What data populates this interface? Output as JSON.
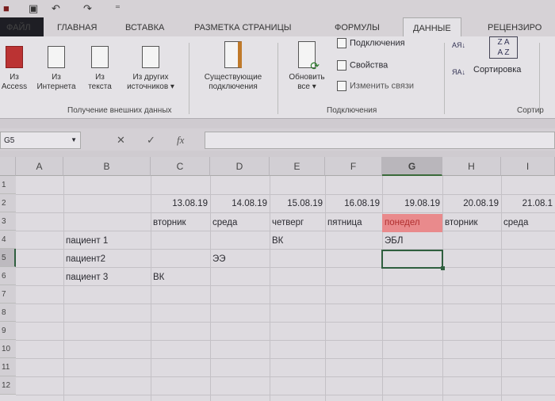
{
  "qat": {
    "icons": [
      "excel-icon",
      "save-icon",
      "undo-icon",
      "redo-icon",
      "customize-icon"
    ]
  },
  "tabs": [
    "ФАЙЛ",
    "ГЛАВНАЯ",
    "ВСТАВКА",
    "РАЗМЕТКА СТРАНИЦЫ",
    "ФОРМУЛЫ",
    "ДАННЫЕ",
    "РЕЦЕНЗИРО"
  ],
  "active_tab": "ДАННЫЕ",
  "ribbon": {
    "external": {
      "label": "Получение внешних данных",
      "buttons": [
        {
          "l1": "Из",
          "l2": "Access"
        },
        {
          "l1": "Из",
          "l2": "Интернета"
        },
        {
          "l1": "Из",
          "l2": "текста"
        },
        {
          "l1": "Из других",
          "l2": "источников ▾"
        }
      ]
    },
    "existing": {
      "l1": "Существующие",
      "l2": "подключения"
    },
    "connections": {
      "label": "Подключения",
      "refresh_l1": "Обновить",
      "refresh_l2": "все ▾",
      "items": [
        "Подключения",
        "Свойства",
        "Изменить связи"
      ]
    },
    "sort": {
      "label": "Сортир",
      "sort": "Сортировка",
      "az": "АЯ",
      "za": "ЯА"
    }
  },
  "formula": {
    "name_box": "G5",
    "cancel": "✕",
    "enter": "✓",
    "fx": "fx",
    "value": ""
  },
  "columns": [
    "A",
    "B",
    "C",
    "D",
    "E",
    "F",
    "G",
    "H",
    "I"
  ],
  "selected_column": "G",
  "rows": [
    "1",
    "2",
    "3",
    "4",
    "5",
    "6",
    "7",
    "8",
    "9",
    "10",
    "11",
    "12"
  ],
  "cells": {
    "dates": [
      "13.08.19",
      "14.08.19",
      "15.08.19",
      "16.08.19",
      "19.08.19",
      "20.08.19",
      "21.08.1"
    ],
    "days": [
      "вторник",
      "среда",
      "четверг",
      "пятница",
      "понедел",
      "вторник",
      "среда"
    ],
    "patients": [
      "пациент 1",
      "пациент2",
      "пациент 3"
    ],
    "e4": "ВК",
    "g4": "ЭБЛ",
    "d5": "ЭЭ",
    "c6": "ВК"
  },
  "colors": {
    "highlight": "#e98a8c",
    "selection": "#2f5f3f"
  }
}
